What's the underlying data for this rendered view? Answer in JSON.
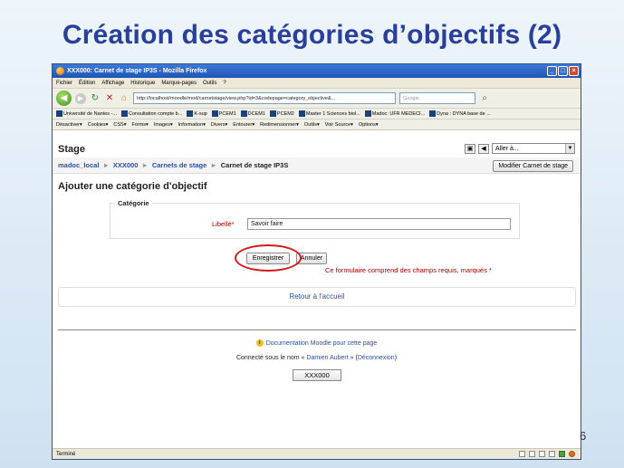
{
  "slide": {
    "title": "Création des catégories d’objectifs (2)",
    "number": "6"
  },
  "browser": {
    "window_title": "XXX000: Carnet de stage IP3S - Mozilla Firefox",
    "menu": [
      "Fichier",
      "Édition",
      "Affichage",
      "Historique",
      "Marque-pages",
      "Outils",
      "?"
    ],
    "url": "http://localhost/moodle/mod/carnetstage/view.php?id=3&codepage=category_objective&...",
    "search_placeholder": "Google",
    "bookmarks": [
      "Université de Nantes -...",
      "Consultation compte b...",
      "K-sup",
      "PCEM1",
      "DCEM1",
      "PCEM2",
      "Master 1 Sciences biol...",
      "Madoc: UFR MEDECI...",
      "Dyna : DYNA base de ..."
    ],
    "devtools": [
      "Désactiver▾",
      "Cookies▾",
      "CSS▾",
      "Forms▾",
      "Images▾",
      "Information▾",
      "Divers▾",
      "Entourer▾",
      "Redimensionner▾",
      "Outils▾",
      "Voir Source▾",
      "Options▾"
    ],
    "status": "Terminé"
  },
  "page": {
    "site_name": "Stage",
    "goto_label": "Aller à...",
    "breadcrumb": [
      "madoc_local",
      "XXX000",
      "Carnets de stage",
      "Carnet de stage IP3S"
    ],
    "edit_button": "Modifier Carnet de stage",
    "heading": "Ajouter une catégorie d'objectif",
    "fieldset_legend": "Catégorie",
    "field_label": "Libellé*",
    "field_value": "Savoir faire",
    "save_label": "Enregistrer",
    "cancel_label": "Annuler",
    "required_note": "Ce formulaire comprend des champs requis, marqués *",
    "home_link": "Retour à l'accueil",
    "doc_link": "Documentation Moodle pour cette page",
    "logged_prefix": "Connecté sous le nom «",
    "user_name": "Damien Aubert",
    "logged_mid": "» (",
    "logout": "Déconnexion",
    "logged_suffix": ")",
    "site_button": "XXX000"
  }
}
